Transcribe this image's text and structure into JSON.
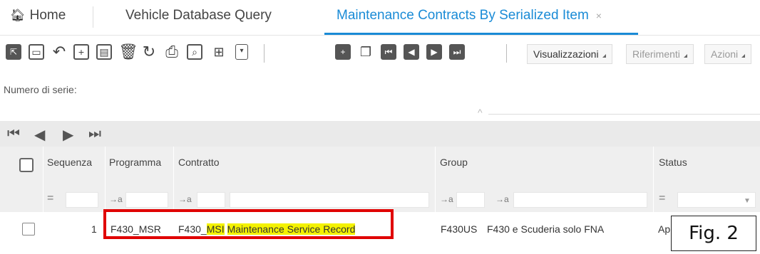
{
  "tabs": {
    "home": "Home",
    "vehicle": "Vehicle Database Query",
    "maintenance": "Maintenance Contracts By Serialized Item",
    "close_glyph": "×"
  },
  "toolbar": {
    "visualizzazioni": "Visualizzazioni",
    "riferimenti": "Riferimenti",
    "azioni": "Azioni"
  },
  "form": {
    "serial_label": "Numero di serie:"
  },
  "grid": {
    "headers": {
      "sequenza": "Sequenza",
      "programma": "Programma",
      "contratto": "Contratto",
      "group": "Group",
      "status": "Status"
    },
    "filter_symbols": {
      "equals": "=",
      "contains": "→a"
    },
    "row": {
      "sequenza": "1",
      "programma": "F430_MSR",
      "contratto_code_pre": "F430_",
      "contratto_code_hl": "MSI",
      "contratto_desc": "Maintenance Service Record",
      "group": "F430US",
      "group_desc": "F430 e Scuderia solo FNA",
      "status": "Ap"
    }
  },
  "figure_label": "Fig. 2",
  "colors": {
    "accent": "#1a8bd6",
    "highlight": "#f4f200",
    "annotation": "#e00000"
  }
}
